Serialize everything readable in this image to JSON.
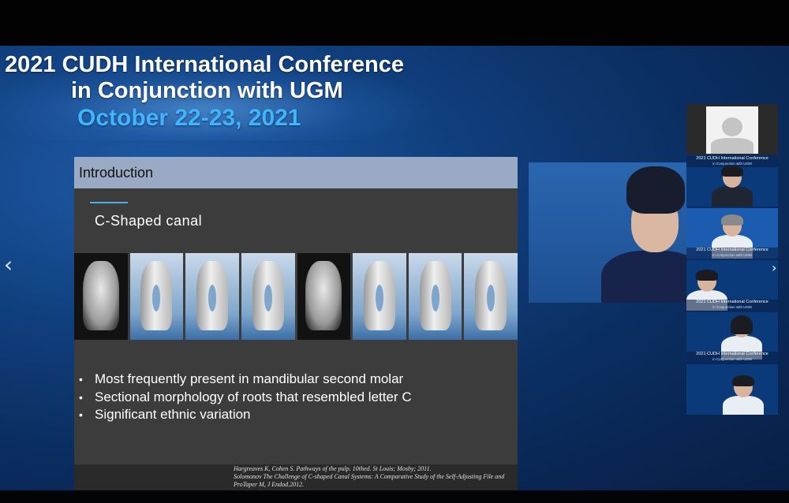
{
  "banner": {
    "title_line1": "2021 CUDH International Conference",
    "title_line2": "in Conjunction with UGM",
    "date": "October 22-23, 2021"
  },
  "slide": {
    "header": "Introduction",
    "subtitle": "C-Shaped canal",
    "bullets": [
      "Most frequently present in mandibular second molar",
      "Sectional morphology of roots that resembled letter C",
      "Significant ethnic variation"
    ],
    "bullet_glyph": "•",
    "references": [
      "Hargreaves K, Cohen S. Pathways of the pulp. 10thed. St Louis; Mosby; 2011.",
      "Solomonov The Challenge of C-shaped Canal Systems: A Comparative Study of the Self-Adjusting File and",
      "ProTaper M, J Endod.2012."
    ]
  },
  "navigation": {
    "prev_glyph": "‹",
    "next_glyph": "›"
  },
  "tiles": {
    "caption_title": "2021 CUDH International Conference",
    "caption_sub": "in Conjunction with UGM"
  },
  "colors": {
    "accent_blue": "#3fb4ff",
    "slide_header": "#9aa9c4",
    "slide_bg": "#3c3c3c"
  }
}
